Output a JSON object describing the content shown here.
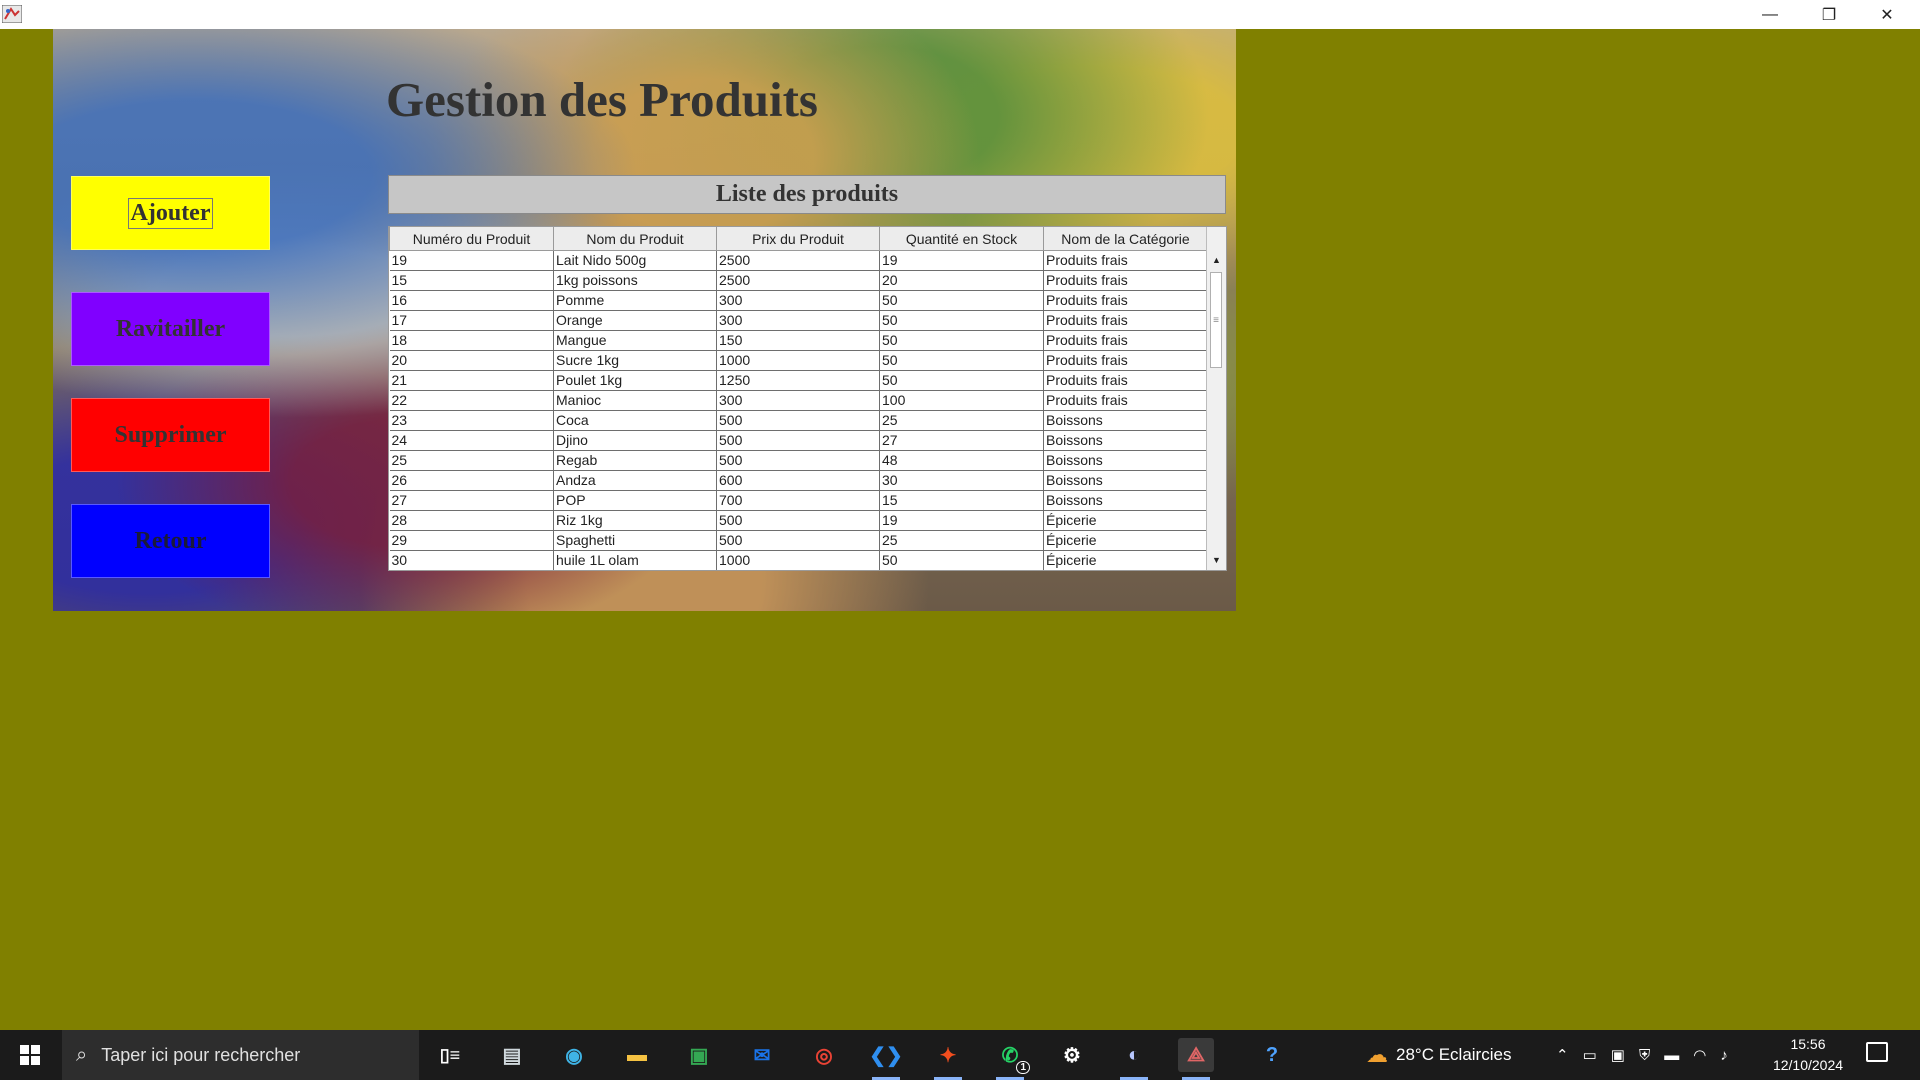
{
  "window": {
    "minimize": "—",
    "restore": "❐",
    "close": "✕"
  },
  "app": {
    "title": "Gestion des Produits",
    "buttons": {
      "ajouter": "Ajouter",
      "ravitailler": "Ravitailler",
      "supprimer": "Supprimer",
      "retour": "Retour"
    },
    "button_colors": {
      "ajouter": "#ffff00",
      "ravitailler": "#8000ff",
      "supprimer": "#ff0000",
      "retour": "#0000ff"
    },
    "list_title": "Liste des produits"
  },
  "table": {
    "columns": [
      "Numéro du Produit",
      "Nom du Produit",
      "Prix du Produit",
      "Quantité en Stock",
      "Nom de la Catégorie"
    ],
    "rows": [
      [
        "19",
        "Lait Nido 500g",
        "2500",
        "19",
        "Produits frais"
      ],
      [
        "15",
        "1kg poissons",
        "2500",
        "20",
        "Produits frais"
      ],
      [
        "16",
        "Pomme",
        "300",
        "50",
        "Produits frais"
      ],
      [
        "17",
        "Orange",
        "300",
        "50",
        "Produits frais"
      ],
      [
        "18",
        "Mangue",
        "150",
        "50",
        "Produits frais"
      ],
      [
        "20",
        "Sucre 1kg",
        "1000",
        "50",
        "Produits frais"
      ],
      [
        "21",
        "Poulet 1kg",
        "1250",
        "50",
        "Produits frais"
      ],
      [
        "22",
        "Manioc",
        "300",
        "100",
        "Produits frais"
      ],
      [
        "23",
        "Coca",
        "500",
        "25",
        "Boissons"
      ],
      [
        "24",
        "Djino",
        "500",
        "27",
        "Boissons"
      ],
      [
        "25",
        "Regab",
        "500",
        "48",
        "Boissons"
      ],
      [
        "26",
        "Andza",
        "600",
        "30",
        "Boissons"
      ],
      [
        "27",
        "POP",
        "700",
        "15",
        "Boissons"
      ],
      [
        "28",
        "Riz 1kg",
        "500",
        "19",
        "Épicerie"
      ],
      [
        "29",
        "Spaghetti",
        "500",
        "25",
        "Épicerie"
      ],
      [
        "30",
        "huile 1L olam",
        "1000",
        "50",
        "Épicerie"
      ]
    ]
  },
  "taskbar": {
    "search_placeholder": "Taper ici pour rechercher",
    "whatsapp_badge": "1",
    "weather": "28°C  Eclaircies",
    "time": "15:56",
    "date": "12/10/2024"
  },
  "colors": {
    "desktop": "#808000",
    "taskbar": "#1b1b1b"
  }
}
